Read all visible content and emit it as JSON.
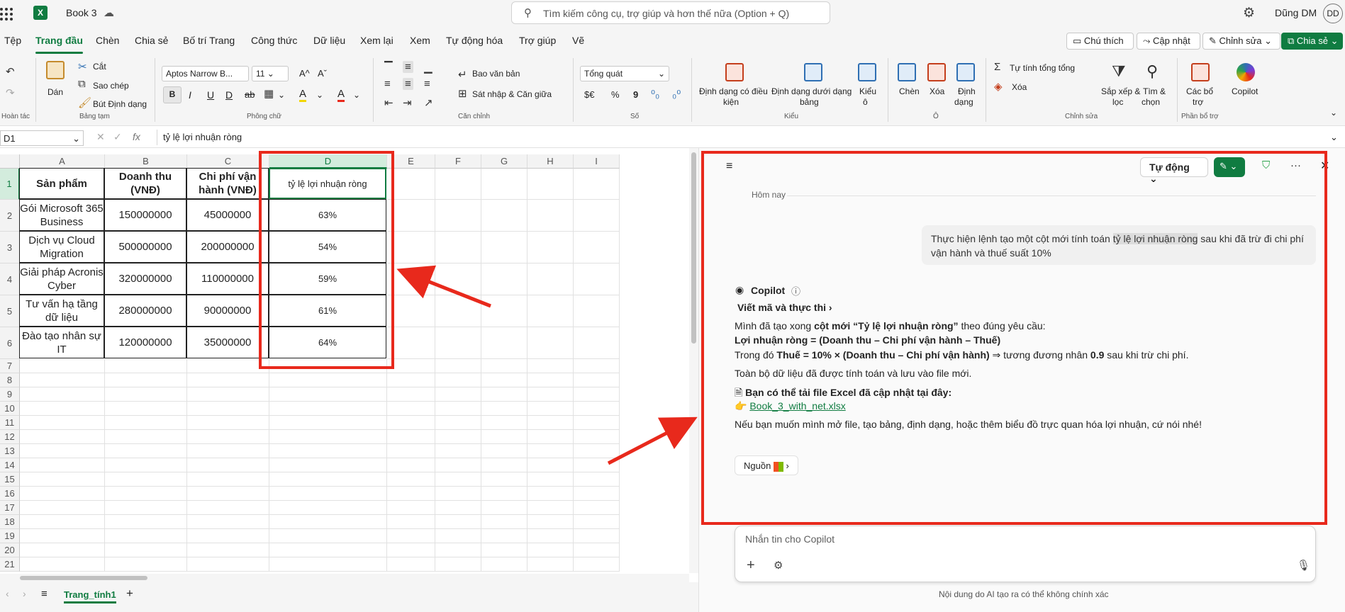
{
  "titlebar": {
    "doc_title": "Book 3",
    "search_placeholder": "Tìm kiếm công cụ, trợ giúp và hơn thế nữa (Option + Q)",
    "user_name": "Dũng DM",
    "user_initials": "DD",
    "app_logo": "X"
  },
  "menu": {
    "tabs": [
      "Tệp",
      "Trang đầu",
      "Chèn",
      "Chia sẻ",
      "Bố trí Trang",
      "Công thức",
      "Dữ liệu",
      "Xem lại",
      "Xem",
      "Tự động hóa",
      "Trợ giúp",
      "Vẽ"
    ],
    "active": "Trang đầu",
    "comments": "Chú thích",
    "catchup": "Cập nhật",
    "editing": "Chỉnh sửa",
    "share": "Chia sẻ"
  },
  "ribbon": {
    "undo_group": "Hoàn tác",
    "clipboard": {
      "paste": "Dán",
      "cut": "Cắt",
      "copy": "Sao chép",
      "format_painter": "Bút Định dạng",
      "group": "Bảng tạm"
    },
    "font": {
      "name": "Aptos Narrow B...",
      "size": "11",
      "group": "Phông chữ",
      "bold": "B",
      "italic": "I",
      "underline": "U",
      "double_underline": "D",
      "strikethrough": "ab",
      "grow": "A^",
      "shrink": "Aˇ",
      "fill_letter": "A",
      "color_letter": "A"
    },
    "alignment": {
      "wrap": "Bao văn bản",
      "merge": "Sát nhập & Căn giữa",
      "group": "Căn chỉnh"
    },
    "number": {
      "format": "Tổng quát",
      "group": "Số",
      "currency": "$€",
      "percent": "%",
      "comma": "9"
    },
    "styles": {
      "conditional_1": "Định dạng có điều",
      "conditional_2": "kiện",
      "table_1": "Định dạng dưới dạng",
      "table_2": "bảng",
      "cell_1": "Kiểu",
      "cell_2": "ô",
      "group": "Kiểu"
    },
    "cells": {
      "insert": "Chèn",
      "delete": "Xóa",
      "format": "Định",
      "format_2": "dạng",
      "group": "Ô"
    },
    "editing": {
      "autosum": "Tự tính tổng tổng",
      "clear": "Xóa",
      "sort_1": "Sắp xếp &",
      "sort_2": "lọc",
      "find_1": "Tìm &",
      "find_2": "chọn",
      "group": "Chỉnh sửa"
    },
    "addins": {
      "label_1": "Các bổ",
      "label_2": "trợ",
      "group": "Phần bổ trợ"
    },
    "copilot": "Copilot"
  },
  "formula_bar": {
    "cell_ref": "D1",
    "fx": "fx",
    "value": "tỷ lệ lợi nhuận ròng"
  },
  "sheet": {
    "columns": [
      "A",
      "B",
      "C",
      "D",
      "E",
      "F",
      "G",
      "H",
      "I"
    ],
    "rows": [
      "1",
      "2",
      "3",
      "4",
      "5",
      "6",
      "7",
      "8",
      "9",
      "10",
      "11",
      "12",
      "13",
      "14",
      "15",
      "16",
      "17",
      "18",
      "19",
      "20",
      "21"
    ],
    "header": [
      "Sản phẩm",
      "Doanh thu (VNĐ)",
      "Chi phí vận hành (VNĐ)",
      "tỷ lệ lợi nhuận ròng"
    ],
    "data": [
      [
        "Gói Microsoft 365 Business",
        "150000000",
        "45000000",
        "63%"
      ],
      [
        "Dịch vụ Cloud Migration",
        "500000000",
        "200000000",
        "54%"
      ],
      [
        "Giải pháp Acronis Cyber",
        "320000000",
        "110000000",
        "59%"
      ],
      [
        "Tư vấn hạ tầng dữ liệu",
        "280000000",
        "90000000",
        "61%"
      ],
      [
        "Đào tạo nhân sự IT",
        "120000000",
        "35000000",
        "64%"
      ]
    ]
  },
  "sheet_tabs": {
    "active": "Trang_tính1"
  },
  "copilot": {
    "mode": "Tự động",
    "date_divider": "Hôm nay",
    "user_prompt_1": "Thực hiện lệnh tạo một cột mới tính toán ",
    "user_prompt_hl": "tỷ lệ lợi nhuận ròng",
    "user_prompt_2": " sau khi đã trừ đi chi phí vận hành và thuế suất 10%",
    "name": "Copilot",
    "step": "Viết mã và thực thi",
    "line1_a": "Mình đã tạo xong ",
    "line1_b": "cột mới “Tỷ lệ lợi nhuận ròng”",
    "line1_c": " theo đúng yêu cầu:",
    "line2": "Lợi nhuận ròng = (Doanh thu – Chi phí vận hành – Thuế)",
    "line3_a": "Trong đó ",
    "line3_b": "Thuế = 10% × (Doanh thu – Chi phí vận hành)",
    "line3_c": " ⇒ tương đương nhân ",
    "line3_d": "0.9",
    "line3_e": " sau khi trừ chi phí.",
    "line4": "Toàn bộ dữ liệu đã được tính toán và lưu vào file mới.",
    "line5": "Bạn có thể tải file Excel đã cập nhật tại đây:",
    "link": "Book_3_with_net.xlsx",
    "line6": "Nếu bạn muốn mình mở file, tạo bảng, định dạng, hoặc thêm biểu đồ trực quan hóa lợi nhuận, cứ nói nhé!",
    "sources": "Nguồn",
    "input_placeholder": "Nhắn tin cho Copilot",
    "disclaimer": "Nội dung do AI tạo ra có thể không chính xác"
  },
  "colors": {
    "excel_green": "#107c41",
    "annotation_red": "#e8291c"
  }
}
